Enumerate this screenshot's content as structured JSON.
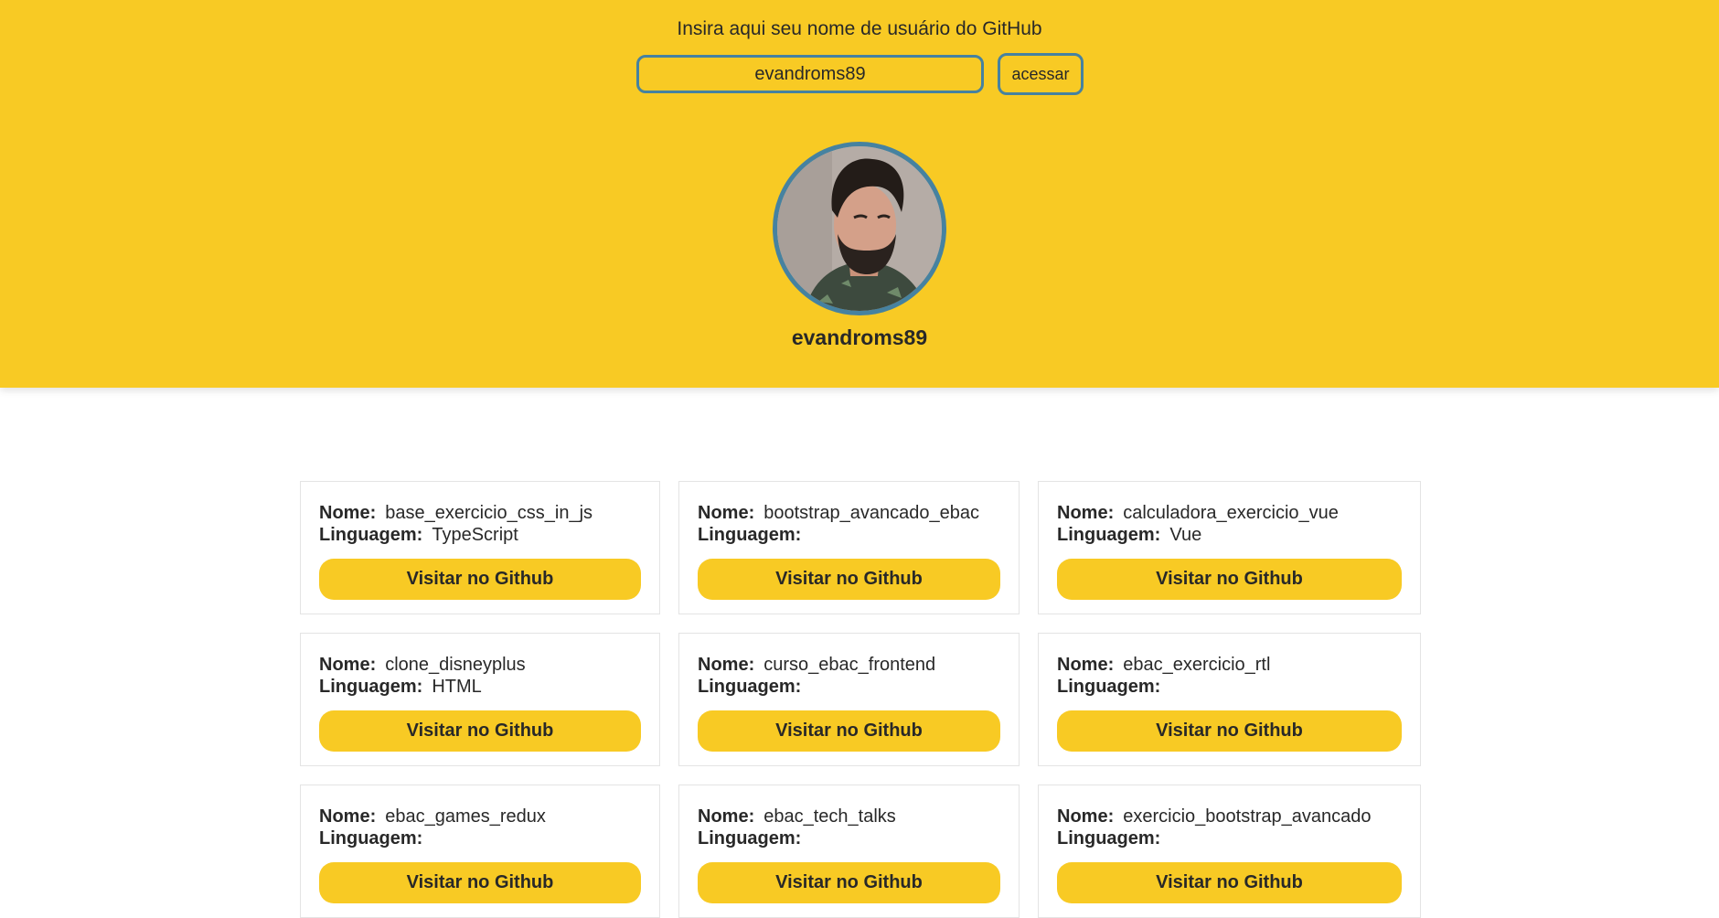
{
  "search": {
    "prompt": "Insira aqui seu nome de usuário do GitHub",
    "value": "evandroms89",
    "button_label": "acessar"
  },
  "profile": {
    "username": "evandroms89"
  },
  "labels": {
    "name": "Nome:",
    "language": "Linguagem:",
    "visit": "Visitar no Github"
  },
  "repos": [
    {
      "name": "base_exercicio_css_in_js",
      "language": "TypeScript"
    },
    {
      "name": "bootstrap_avancado_ebac",
      "language": ""
    },
    {
      "name": "calculadora_exercicio_vue",
      "language": "Vue"
    },
    {
      "name": "clone_disneyplus",
      "language": "HTML"
    },
    {
      "name": "curso_ebac_frontend",
      "language": ""
    },
    {
      "name": "ebac_exercicio_rtl",
      "language": ""
    },
    {
      "name": "ebac_games_redux",
      "language": ""
    },
    {
      "name": "ebac_tech_talks",
      "language": ""
    },
    {
      "name": "exercicio_bootstrap_avancado",
      "language": ""
    }
  ],
  "colors": {
    "accent": "#f8ca24",
    "border": "#4682a0",
    "text": "#282828"
  }
}
